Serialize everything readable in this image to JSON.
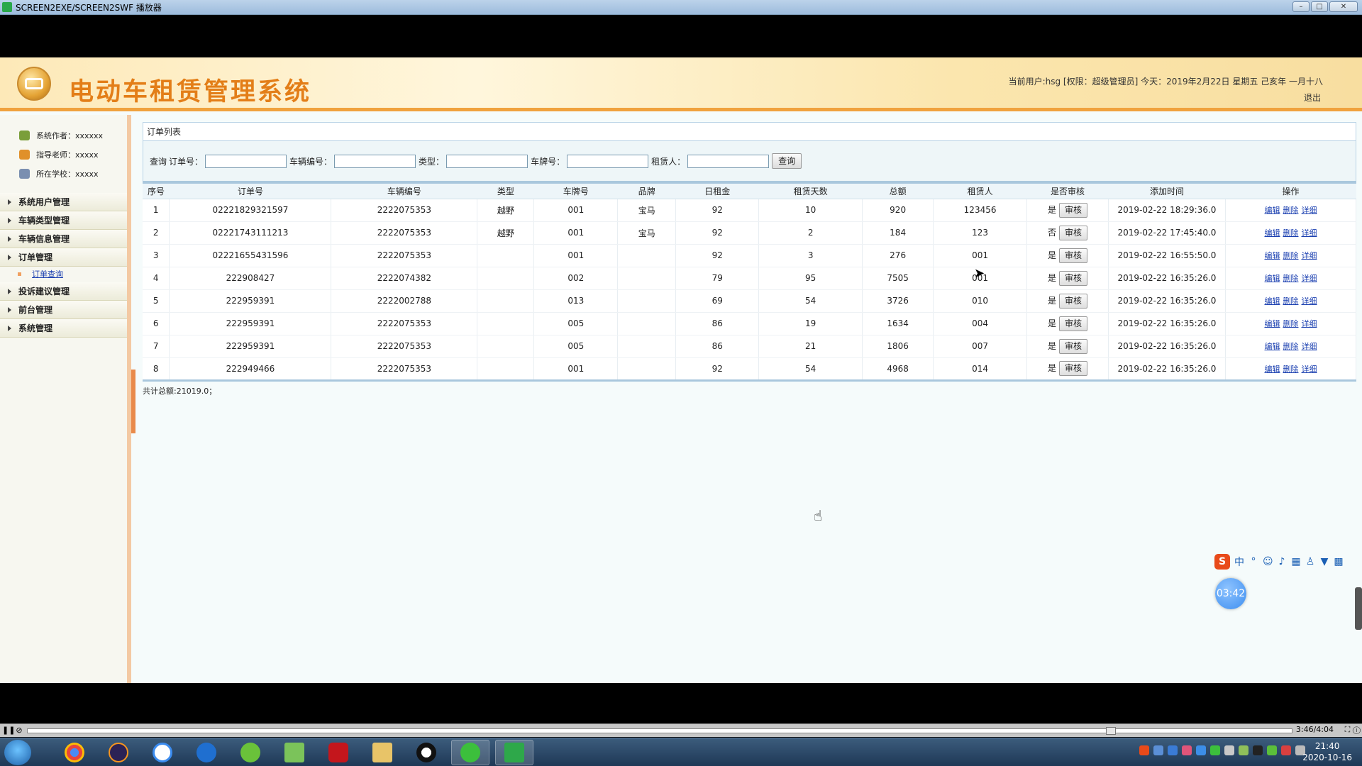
{
  "window": {
    "title": "SCREEN2EXE/SCREEN2SWF 播放器",
    "minimize": "–",
    "maximize": "□",
    "close": "✕"
  },
  "header": {
    "title": "电动车租赁管理系统",
    "user_info": "当前用户:hsg [权限：超级管理员] 今天：2019年2月22日 星期五 己亥年 一月十八",
    "logout": "退出"
  },
  "sidebar": {
    "info": [
      {
        "label": "系统作者：xxxxxx",
        "color": "#7a9e3a"
      },
      {
        "label": "指导老师：xxxxx",
        "color": "#e0902a"
      },
      {
        "label": "所在学校：xxxxx",
        "color": "#7a8fb0"
      }
    ],
    "menu": [
      "系统用户管理",
      "车辆类型管理",
      "车辆信息管理",
      "订单管理"
    ],
    "submenu": [
      "订单查询"
    ],
    "menu_after": [
      "投诉建议管理",
      "前台管理",
      "系统管理"
    ]
  },
  "panel": {
    "title": "订单列表"
  },
  "search": {
    "prefix": "查询",
    "fields": [
      "订单号：",
      "车辆编号：",
      "类型：",
      "车牌号：",
      "租赁人："
    ],
    "button": "查询"
  },
  "table": {
    "columns": [
      "序号",
      "订单号",
      "车辆编号",
      "类型",
      "车牌号",
      "品牌",
      "日租金",
      "租赁天数",
      "总额",
      "租赁人",
      "是否审核",
      "添加时间",
      "操作"
    ],
    "audit_button": "审核",
    "ops": [
      "编辑",
      "删除",
      "详细"
    ],
    "rows": [
      [
        "1",
        "02221829321597",
        "2222075353",
        "越野",
        "001",
        "宝马",
        "92",
        "10",
        "920",
        "123456",
        "是",
        "2019-02-22 18:29:36.0"
      ],
      [
        "2",
        "02221743111213",
        "2222075353",
        "越野",
        "001",
        "宝马",
        "92",
        "2",
        "184",
        "123",
        "否",
        "2019-02-22 17:45:40.0"
      ],
      [
        "3",
        "02221655431596",
        "2222075353",
        "",
        "001",
        "",
        "92",
        "3",
        "276",
        "001",
        "是",
        "2019-02-22 16:55:50.0"
      ],
      [
        "4",
        "222908427",
        "2222074382",
        "",
        "002",
        "",
        "79",
        "95",
        "7505",
        "001",
        "是",
        "2019-02-22 16:35:26.0"
      ],
      [
        "5",
        "222959391",
        "2222002788",
        "",
        "013",
        "",
        "69",
        "54",
        "3726",
        "010",
        "是",
        "2019-02-22 16:35:26.0"
      ],
      [
        "6",
        "222959391",
        "2222075353",
        "",
        "005",
        "",
        "86",
        "19",
        "1634",
        "004",
        "是",
        "2019-02-22 16:35:26.0"
      ],
      [
        "7",
        "222959391",
        "2222075353",
        "",
        "005",
        "",
        "86",
        "21",
        "1806",
        "007",
        "是",
        "2019-02-22 16:35:26.0"
      ],
      [
        "8",
        "222949466",
        "2222075353",
        "",
        "001",
        "",
        "92",
        "54",
        "4968",
        "014",
        "是",
        "2019-02-22 16:35:26.0"
      ]
    ]
  },
  "total": "共计总额:21019.0；",
  "overlay": {
    "timer": "03:42",
    "ime_logo": "S",
    "ime_mode": "中"
  },
  "player": {
    "time": "3:46/4:04",
    "progress": 0.86
  },
  "taskbar": {
    "time": "21:40",
    "date": "2020-10-16"
  }
}
